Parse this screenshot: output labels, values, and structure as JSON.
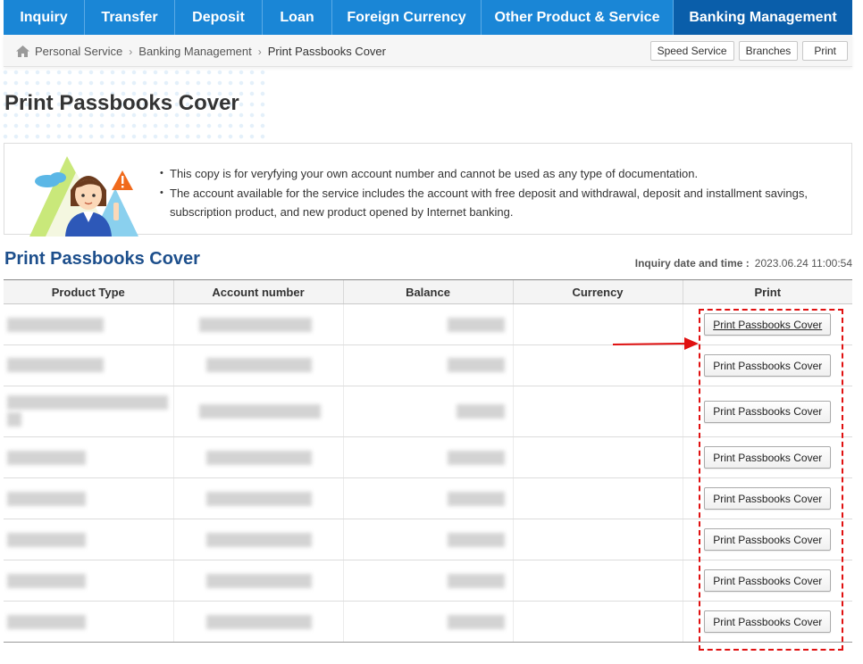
{
  "nav": {
    "items": [
      {
        "label": "Inquiry",
        "active": false
      },
      {
        "label": "Transfer",
        "active": false
      },
      {
        "label": "Deposit",
        "active": false
      },
      {
        "label": "Loan",
        "active": false
      },
      {
        "label": "Foreign Currency",
        "active": false
      },
      {
        "label": "Other Product & Service",
        "active": false
      },
      {
        "label": "Banking Management",
        "active": true
      }
    ]
  },
  "breadcrumb": {
    "items": [
      "Personal Service",
      "Banking Management",
      "Print Passbooks Cover"
    ]
  },
  "quick_buttons": {
    "speed": "Speed Service",
    "branches": "Branches",
    "print": "Print"
  },
  "page": {
    "title": "Print Passbooks Cover"
  },
  "notice": {
    "line1": "This copy is for veryfying your own account number and cannot be used as any type of documentation.",
    "line2": "The account available for the service includes the account with free deposit and withdrawal, deposit and installment savings, subscription product, and new product opened by Internet banking."
  },
  "section": {
    "title": "Print Passbooks Cover",
    "inquiry_label": "Inquiry date and time :",
    "inquiry_value": "2023.06.24 11:00:54"
  },
  "table": {
    "headers": [
      "Product Type",
      "Account number",
      "Balance",
      "Currency",
      "Print"
    ],
    "row_button_label": "Print Passbooks Cover",
    "row_count": 8
  },
  "colors": {
    "nav_bg": "#1a86d6",
    "nav_active": "#0a5eaa",
    "section_title": "#1d4f8c",
    "annotation": "#e01010"
  }
}
